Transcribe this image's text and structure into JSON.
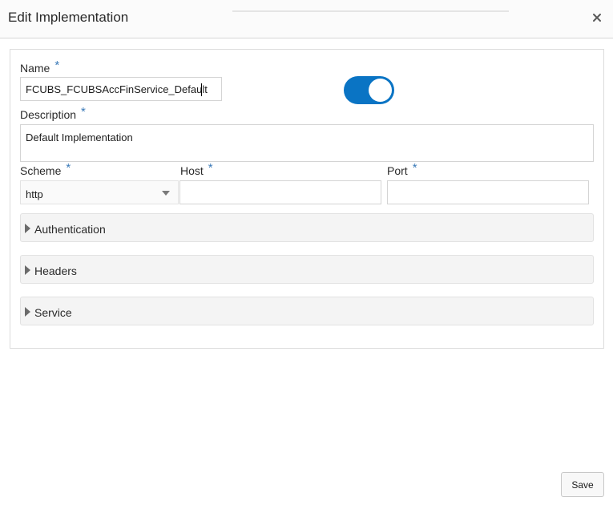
{
  "dialog": {
    "title": "Edit Implementation",
    "close_icon": "close-icon"
  },
  "form": {
    "required_mark": "*",
    "name": {
      "label": "Name",
      "value": "FCUBS_FCUBSAccFinService_Default"
    },
    "toggle": {
      "on": true,
      "color": "#0a74c4"
    },
    "description": {
      "label": "Description",
      "value": "Default Implementation"
    },
    "scheme": {
      "label": "Scheme",
      "value": "http",
      "icon": "chevron-down-icon"
    },
    "host": {
      "label": "Host",
      "value": ""
    },
    "port": {
      "label": "Port",
      "value": ""
    },
    "sections": [
      {
        "label": "Authentication",
        "icon": "caret-right-icon"
      },
      {
        "label": "Headers",
        "icon": "caret-right-icon"
      },
      {
        "label": "Service",
        "icon": "caret-right-icon"
      }
    ]
  },
  "footer": {
    "save_label": "Save"
  }
}
